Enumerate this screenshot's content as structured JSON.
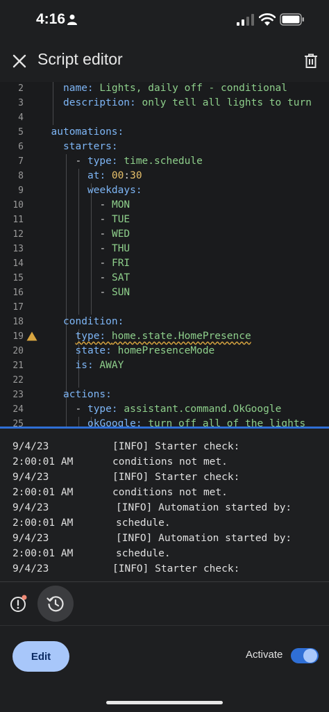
{
  "status_bar": {
    "time": "4:16"
  },
  "app_bar": {
    "title": "Script editor"
  },
  "editor": {
    "lines": [
      {
        "num": "2",
        "indent": "  ",
        "parts": [
          [
            "k",
            "name: "
          ],
          [
            "v",
            "Lights, daily off - conditional"
          ]
        ]
      },
      {
        "num": "3",
        "indent": "  ",
        "parts": [
          [
            "k",
            "description: "
          ],
          [
            "v",
            "only tell all lights to turn"
          ]
        ]
      },
      {
        "num": "4",
        "indent": "",
        "parts": []
      },
      {
        "num": "5",
        "indent": "",
        "parts": [
          [
            "k",
            "automations:"
          ]
        ]
      },
      {
        "num": "6",
        "indent": "  ",
        "parts": [
          [
            "k",
            "starters:"
          ]
        ]
      },
      {
        "num": "7",
        "indent": "    ",
        "parts": [
          [
            "p",
            "- "
          ],
          [
            "k",
            "type: "
          ],
          [
            "v",
            "time.schedule"
          ]
        ]
      },
      {
        "num": "8",
        "indent": "      ",
        "parts": [
          [
            "k",
            "at: "
          ],
          [
            "n",
            "00"
          ],
          [
            "p",
            ":"
          ],
          [
            "n",
            "30"
          ]
        ]
      },
      {
        "num": "9",
        "indent": "      ",
        "parts": [
          [
            "k",
            "weekdays:"
          ]
        ]
      },
      {
        "num": "10",
        "indent": "        ",
        "parts": [
          [
            "p",
            "- "
          ],
          [
            "v",
            "MON"
          ]
        ]
      },
      {
        "num": "11",
        "indent": "        ",
        "parts": [
          [
            "p",
            "- "
          ],
          [
            "v",
            "TUE"
          ]
        ]
      },
      {
        "num": "12",
        "indent": "        ",
        "parts": [
          [
            "p",
            "- "
          ],
          [
            "v",
            "WED"
          ]
        ]
      },
      {
        "num": "13",
        "indent": "        ",
        "parts": [
          [
            "p",
            "- "
          ],
          [
            "v",
            "THU"
          ]
        ]
      },
      {
        "num": "14",
        "indent": "        ",
        "parts": [
          [
            "p",
            "- "
          ],
          [
            "v",
            "FRI"
          ]
        ]
      },
      {
        "num": "15",
        "indent": "        ",
        "parts": [
          [
            "p",
            "- "
          ],
          [
            "v",
            "SAT"
          ]
        ]
      },
      {
        "num": "16",
        "indent": "        ",
        "parts": [
          [
            "p",
            "- "
          ],
          [
            "v",
            "SUN"
          ]
        ]
      },
      {
        "num": "17",
        "indent": "",
        "parts": []
      },
      {
        "num": "18",
        "indent": "  ",
        "parts": [
          [
            "k",
            "condition:"
          ]
        ]
      },
      {
        "num": "19",
        "indent": "    ",
        "parts": [
          [
            "ks",
            "type: "
          ],
          [
            "vs",
            "home.state.HomePresence"
          ]
        ],
        "warning": true
      },
      {
        "num": "20",
        "indent": "    ",
        "parts": [
          [
            "k",
            "state: "
          ],
          [
            "v",
            "homePresenceMode"
          ]
        ]
      },
      {
        "num": "21",
        "indent": "    ",
        "parts": [
          [
            "k",
            "is: "
          ],
          [
            "v",
            "AWAY"
          ]
        ]
      },
      {
        "num": "22",
        "indent": "",
        "parts": []
      },
      {
        "num": "23",
        "indent": "  ",
        "parts": [
          [
            "k",
            "actions:"
          ]
        ]
      },
      {
        "num": "24",
        "indent": "    ",
        "parts": [
          [
            "p",
            "- "
          ],
          [
            "k",
            "type: "
          ],
          [
            "v",
            "assistant.command.OkGoogle"
          ]
        ]
      },
      {
        "num": "25",
        "indent": "      ",
        "parts": [
          [
            "k",
            "okGoogle: "
          ],
          [
            "v",
            "turn off all of the lights"
          ]
        ]
      }
    ]
  },
  "logs": [
    {
      "date": "9/4/23",
      "time": "2:00:01 AM",
      "msg1": "[INFO] Starter check:",
      "msg2": "conditions not met.",
      "indent": false
    },
    {
      "date": "9/4/23",
      "time": "2:00:01 AM",
      "msg1": "[INFO] Starter check:",
      "msg2": "conditions not met.",
      "indent": false
    },
    {
      "date": "9/4/23",
      "time": "2:00:01 AM",
      "msg1": "[INFO] Automation started by:",
      "msg2": "schedule.",
      "indent": true
    },
    {
      "date": "9/4/23",
      "time": "2:00:01 AM",
      "msg1": "[INFO] Automation started by:",
      "msg2": "schedule.",
      "indent": true
    },
    {
      "date": "9/4/23",
      "time": "",
      "msg1": "[INFO] Starter check:",
      "msg2": "",
      "indent": false
    }
  ],
  "bottom_bar": {
    "edit_label": "Edit",
    "activate_label": "Activate",
    "activate_on": true
  },
  "colors": {
    "accent": "#a8c7fa",
    "toggle_track": "#2f6fd6",
    "key": "#7eb6f6",
    "value": "#8ecf8b",
    "number": "#e7c06a",
    "warning": "#d8a540"
  }
}
